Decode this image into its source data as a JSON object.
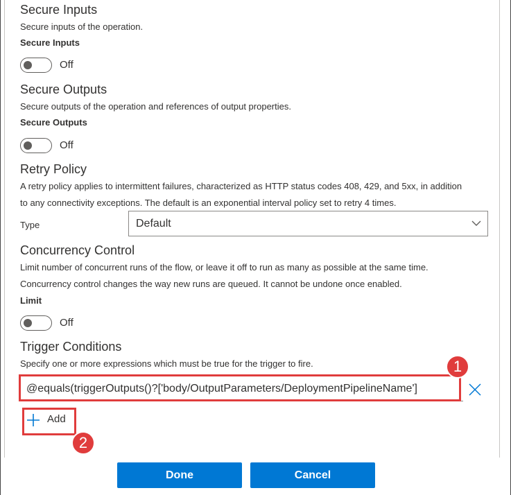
{
  "secure_inputs": {
    "title": "Secure Inputs",
    "description": "Secure inputs of the operation.",
    "label": "Secure Inputs",
    "state": "Off"
  },
  "secure_outputs": {
    "title": "Secure Outputs",
    "description": "Secure outputs of the operation and references of output properties.",
    "label": "Secure Outputs",
    "state": "Off"
  },
  "retry_policy": {
    "title": "Retry Policy",
    "description_line1": "A retry policy applies to intermittent failures, characterized as HTTP status codes 408, 429, and 5xx, in addition",
    "description_line2": "to any connectivity exceptions. The default is an exponential interval policy set to retry 4 times.",
    "type_label": "Type",
    "type_value": "Default"
  },
  "concurrency": {
    "title": "Concurrency Control",
    "description_line1": "Limit number of concurrent runs of the flow, or leave it off to run as many as possible at the same time.",
    "description_line2": "Concurrency control changes the way new runs are queued. It cannot be undone once enabled.",
    "label": "Limit",
    "state": "Off"
  },
  "trigger_conditions": {
    "title": "Trigger Conditions",
    "description": "Specify one or more expressions which must be true for the trigger to fire.",
    "condition_value": "@equals(triggerOutputs()?['body/OutputParameters/DeploymentPipelineName']",
    "add_label": "Add"
  },
  "annotations": {
    "badge1": "1",
    "badge2": "2",
    "color": "#e03c3c"
  },
  "footer": {
    "done_label": "Done",
    "cancel_label": "Cancel"
  },
  "colors": {
    "primary": "#0078d4",
    "text": "#323130"
  }
}
